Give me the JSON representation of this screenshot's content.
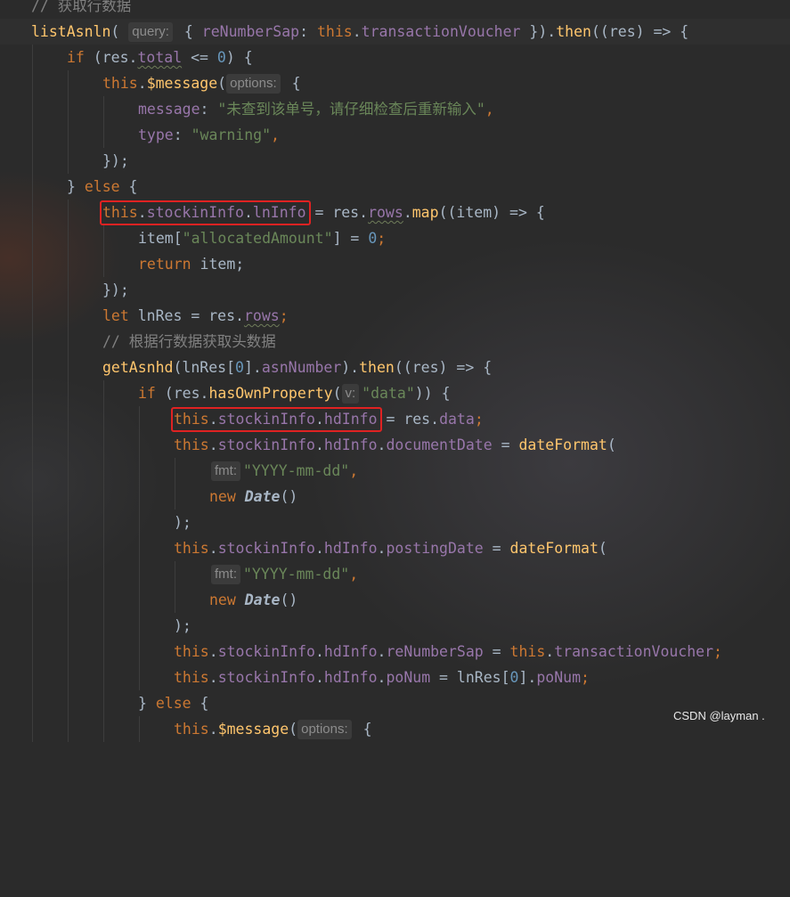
{
  "code": {
    "l0": {
      "comment": "// 获取行数据"
    },
    "l1": {
      "fn": "listAsnln",
      "paren": "(",
      "hint": "query:",
      "brace": " { ",
      "prop": "reNumberSap",
      "colon": ": ",
      "this": "this",
      "dot": ".",
      "field": "transactionVoucher",
      "close": " }).",
      "then": "then",
      "rest": "((res) => {"
    },
    "l2": {
      "kw": "if",
      "a": " (res.",
      "field": "total",
      "b": " <= ",
      "num": "0",
      "c": ") {"
    },
    "l3": {
      "this": "this",
      "dot": ".",
      "fn": "$message",
      "paren": "(",
      "hint": "options:",
      "brace": " {"
    },
    "l4": {
      "prop": "message",
      "colon": ": ",
      "str": "\"未查到该单号，请仔细检查后重新输入\"",
      "comma": ","
    },
    "l5": {
      "prop": "type",
      "colon": ": ",
      "str": "\"warning\"",
      "comma": ","
    },
    "l6": {
      "text": "});"
    },
    "l7": {
      "a": "} ",
      "kw": "else",
      "b": " {"
    },
    "l8": {
      "this": "this",
      "dot1": ".",
      "f1": "stockinInfo",
      "dot2": ".",
      "f2": "lnInfo",
      "eq": " = res.",
      "rows": "rows",
      "dot3": ".",
      "map": "map",
      "rest": "((item) => {"
    },
    "l9": {
      "a": "item[",
      "str": "\"allocatedAmount\"",
      "b": "] = ",
      "num": "0",
      "c": ";"
    },
    "l10": {
      "kw": "return",
      "rest": " item;"
    },
    "l11": {
      "text": "});"
    },
    "l12": {
      "kw": "let",
      "a": " lnRes = res.",
      "rows": "rows",
      "c": ";"
    },
    "l13": {
      "comment": "// 根据行数据获取头数据"
    },
    "l14": {
      "fn": "getAsnhd",
      "a": "(lnRes[",
      "num": "0",
      "b": "].",
      "field": "asnNumber",
      "c": ").",
      "then": "then",
      "rest": "((res) => {"
    },
    "l15": {
      "kw": "if",
      "a": " (res.",
      "fn": "hasOwnProperty",
      "paren": "(",
      "hint": "v:",
      "str": "\"data\"",
      "c": ")) {"
    },
    "l16": {
      "this": "this",
      "dot1": ".",
      "f1": "stockinInfo",
      "dot2": ".",
      "f2": "hdInfo",
      "eq": " = res.",
      "data": "data",
      "c": ";"
    },
    "l17": {
      "this": "this",
      "dot1": ".",
      "f1": "stockinInfo",
      "dot2": ".",
      "f2": "hdInfo",
      "dot3": ".",
      "f3": "documentDate",
      "eq": " = ",
      "fn": "dateFormat",
      "c": "("
    },
    "l18": {
      "hint": "fmt:",
      "str": "\"YYYY-mm-dd\"",
      "c": ","
    },
    "l19": {
      "kw": "new",
      "sp": " ",
      "cls": "Date",
      "c": "()"
    },
    "l20": {
      "text": ");"
    },
    "l21": {
      "this": "this",
      "dot1": ".",
      "f1": "stockinInfo",
      "dot2": ".",
      "f2": "hdInfo",
      "dot3": ".",
      "f3": "postingDate",
      "eq": " = ",
      "fn": "dateFormat",
      "c": "("
    },
    "l22": {
      "hint": "fmt:",
      "str": "\"YYYY-mm-dd\"",
      "c": ","
    },
    "l23": {
      "kw": "new",
      "sp": " ",
      "cls": "Date",
      "c": "()"
    },
    "l24": {
      "text": ");"
    },
    "l25": {
      "this": "this",
      "dot1": ".",
      "f1": "stockinInfo",
      "dot2": ".",
      "f2": "hdInfo",
      "dot3": ".",
      "f3": "reNumberSap",
      "eq": " = ",
      "this2": "this",
      "dot4": ".",
      "f4": "transactionVoucher",
      "c": ";"
    },
    "l26": {
      "this": "this",
      "dot1": ".",
      "f1": "stockinInfo",
      "dot2": ".",
      "f2": "hdInfo",
      "dot3": ".",
      "f3": "poNum",
      "a": " = lnRes[",
      "num": "0",
      "b": "].",
      "f4": "poNum",
      "c": ";"
    },
    "l27": {
      "a": "} ",
      "kw": "else",
      "b": " {"
    },
    "l28": {
      "this": "this",
      "dot": ".",
      "fn": "$message",
      "paren": "(",
      "hint": "options:",
      "brace": " {"
    }
  },
  "watermark": "CSDN @layman  .",
  "colors": {
    "background": "#2b2b2b",
    "keyword": "#cc7832",
    "function": "#ffc66d",
    "property": "#9876aa",
    "string": "#6a8759",
    "number": "#6897bb",
    "comment": "#808080",
    "identifier": "#a9b7c6",
    "highlight_box": "#e02222"
  }
}
